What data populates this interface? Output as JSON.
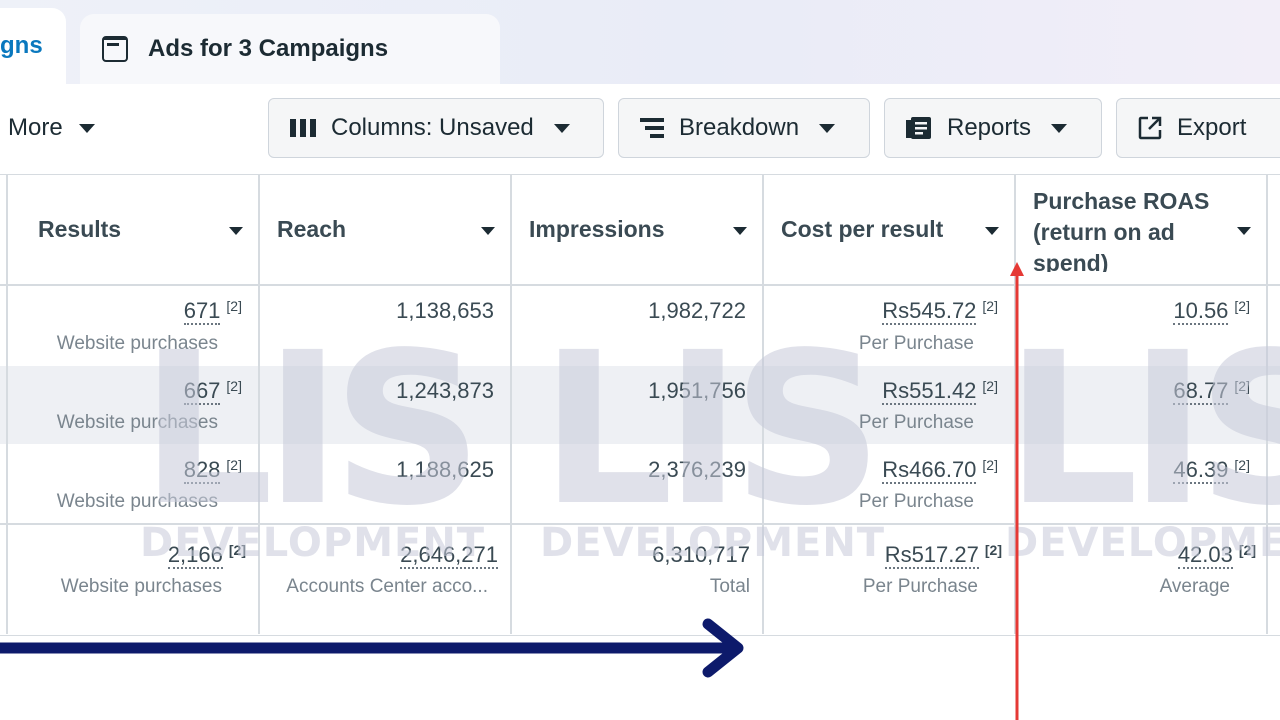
{
  "tabs": [
    {
      "label": "gns"
    },
    {
      "label": "Ads for 3 Campaigns"
    }
  ],
  "toolbar": {
    "more": "More",
    "columns": "Columns: Unsaved",
    "breakdown": "Breakdown",
    "reports": "Reports",
    "export": "Export"
  },
  "headers": {
    "results": "Results",
    "reach": "Reach",
    "impressions": "Impressions",
    "cost": "Cost per result",
    "roas_line1": "Purchase ROAS",
    "roas_line2": "(return on ad",
    "roas_line3": "spend)"
  },
  "rows": [
    {
      "results": "671",
      "results_sub": "Website purchases",
      "reach": "1,138,653",
      "impressions": "1,982,722",
      "cost": "Rs545.72",
      "cost_sub": "Per Purchase",
      "roas": "10.56"
    },
    {
      "results": "667",
      "results_sub": "Website purchases",
      "reach": "1,243,873",
      "impressions": "1,951,756",
      "cost": "Rs551.42",
      "cost_sub": "Per Purchase",
      "roas": "68.77"
    },
    {
      "results": "828",
      "results_sub": "Website purchases",
      "reach": "1,188,625",
      "impressions": "2,376,239",
      "cost": "Rs466.70",
      "cost_sub": "Per Purchase",
      "roas": "46.39"
    }
  ],
  "totals": {
    "results": "2,166",
    "results_sub": "Website purchases",
    "reach": "2,646,271",
    "reach_sub": "Accounts Center acco...",
    "impressions": "6,310,717",
    "impressions_sub": "Total",
    "cost": "Rs517.27",
    "cost_sub": "Per Purchase",
    "roas": "42.03",
    "roas_sub": "Average"
  },
  "footnote": "[2]",
  "watermark": {
    "letters": "LIS",
    "text": "DEVELOPMENT"
  },
  "colors": {
    "accent_tab": "#0a78be",
    "arrow_blue": "#0d1a6b",
    "arrow_red": "#e53935"
  }
}
